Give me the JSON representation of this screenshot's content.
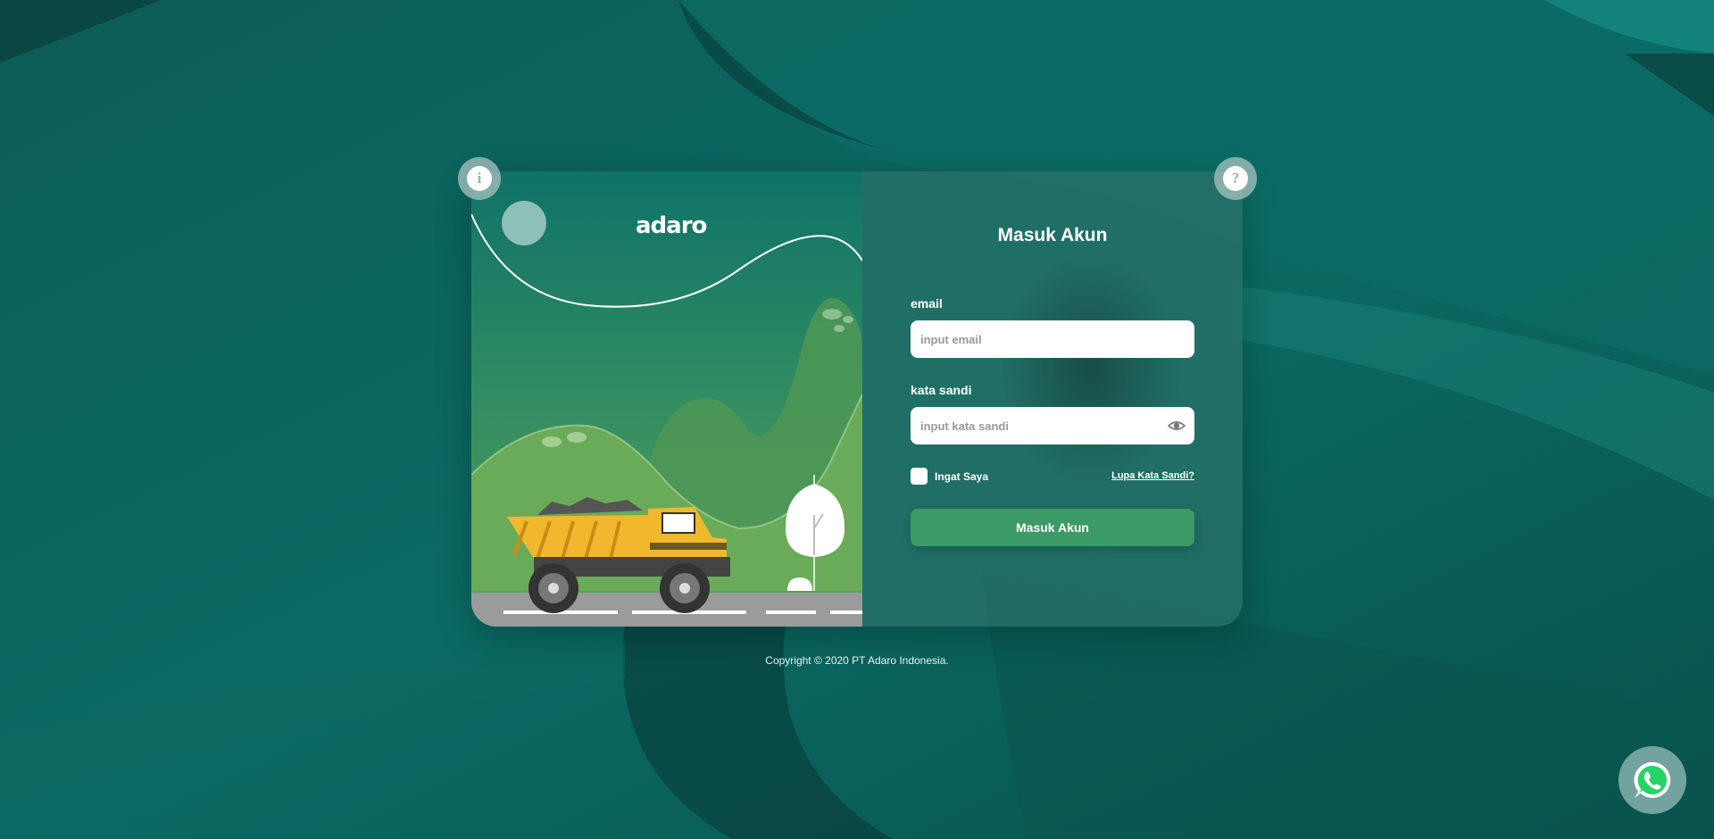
{
  "brand": {
    "logo_text": "adaro"
  },
  "login": {
    "title": "Masuk Akun",
    "email_label": "email",
    "email_placeholder": "input email",
    "password_label": "kata sandi",
    "password_placeholder": "input kata sandi",
    "remember_label": "Ingat Saya",
    "forgot_label": "Lupa Kata Sandi?",
    "submit_label": "Masuk Akun"
  },
  "corner": {
    "info_glyph": "i",
    "help_glyph": "?"
  },
  "footer": {
    "copyright": "Copyright © 2020 PT Adaro Indonesia."
  },
  "icons": {
    "info": "info-icon",
    "help": "help-icon",
    "eye": "eye-icon",
    "whatsapp": "whatsapp-icon"
  },
  "colors": {
    "background": "#0b5d58",
    "panel": "#267068",
    "button": "#3c9a66",
    "truck": "#f1b82d"
  }
}
